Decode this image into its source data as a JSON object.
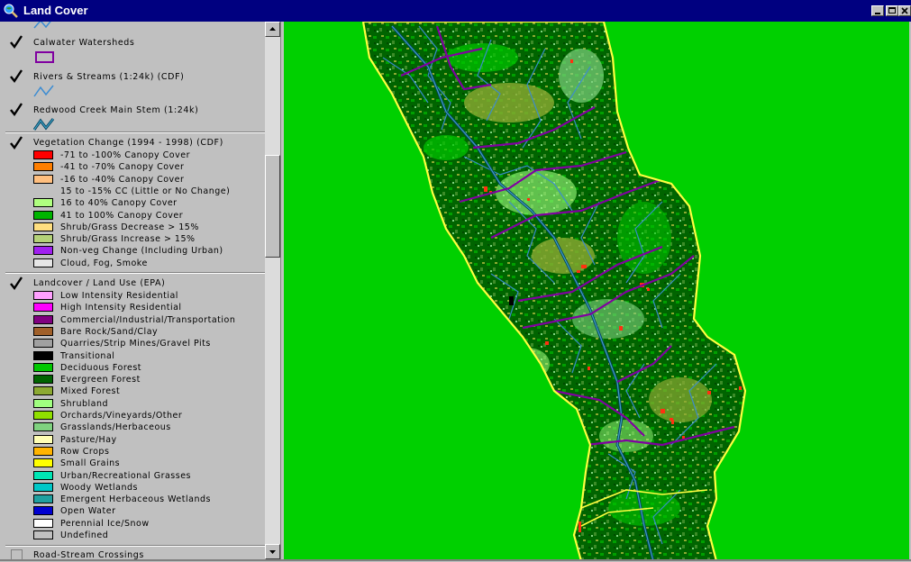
{
  "window": {
    "title": "Land Cover",
    "icon": "globe-magnifier-icon"
  },
  "legend": {
    "themes": [
      {
        "name": "Calwater Watersheds",
        "checked": true,
        "symbol": "purple-polygon"
      },
      {
        "name": "Rivers & Streams (1:24k) (CDF)",
        "checked": true,
        "symbol": "blue-line"
      },
      {
        "name": "Redwood Creek Main Stem (1:24k)",
        "checked": true,
        "symbol": "teal-line"
      },
      {
        "name": "Vegetation Change (1994 - 1998) (CDF)",
        "checked": true,
        "entries": [
          {
            "label": "-71 to -100% Canopy Cover",
            "color": "#ff0000"
          },
          {
            "label": "-41 to -70% Canopy Cover",
            "color": "#ff7f00"
          },
          {
            "label": "-16 to -40% Canopy Cover",
            "color": "#ffbf7f"
          },
          {
            "label": "15 to -15% CC (Little or No Change)",
            "color": ""
          },
          {
            "label": "16 to 40% Canopy Cover",
            "color": "#afff7f"
          },
          {
            "label": "41 to 100% Canopy Cover",
            "color": "#00b400"
          },
          {
            "label": "Shrub/Grass Decrease > 15%",
            "color": "#ffdf80"
          },
          {
            "label": "Shrub/Grass Increase > 15%",
            "color": "#b4d278"
          },
          {
            "label": "Non-veg Change (Including Urban)",
            "color": "#a020f0"
          },
          {
            "label": "Cloud, Fog, Smoke",
            "color": "#e6e6e6"
          }
        ]
      },
      {
        "name": "Landcover / Land Use (EPA)",
        "checked": true,
        "entries": [
          {
            "label": "Low Intensity Residential",
            "color": "#ffa0ff"
          },
          {
            "label": "High Intensity Residential",
            "color": "#ff00ff"
          },
          {
            "label": "Commercial/Industrial/Transportation",
            "color": "#800080"
          },
          {
            "label": "Bare Rock/Sand/Clay",
            "color": "#a0602a"
          },
          {
            "label": "Quarries/Strip Mines/Gravel Pits",
            "color": "#a0a0a0"
          },
          {
            "label": "Transitional",
            "color": "#000000"
          },
          {
            "label": "Deciduous Forest",
            "color": "#00c800"
          },
          {
            "label": "Evergreen Forest",
            "color": "#006400"
          },
          {
            "label": "Mixed Forest",
            "color": "#8caa32"
          },
          {
            "label": "Shrubland",
            "color": "#a0ff80"
          },
          {
            "label": "Orchards/Vineyards/Other",
            "color": "#90e000"
          },
          {
            "label": "Grasslands/Herbaceous",
            "color": "#7fd27f"
          },
          {
            "label": "Pasture/Hay",
            "color": "#ffffb4"
          },
          {
            "label": "Row Crops",
            "color": "#ffb400"
          },
          {
            "label": "Small Grains",
            "color": "#ffff00"
          },
          {
            "label": "Urban/Recreational Grasses",
            "color": "#00e6b4"
          },
          {
            "label": "Woody Wetlands",
            "color": "#00c8c8"
          },
          {
            "label": "Emergent Herbaceous Wetlands",
            "color": "#20a0a0"
          },
          {
            "label": "Open Water",
            "color": "#0000d0"
          },
          {
            "label": "Perennial Ice/Snow",
            "color": "#ffffff"
          },
          {
            "label": "Undefined",
            "color": "#c0c0c0"
          }
        ]
      },
      {
        "name": "Road-Stream Crossings",
        "checked": false
      }
    ]
  },
  "map": {
    "background_color": "#00d000",
    "boundary_color": "#ffff40",
    "watershed_line_color": "#8000a0",
    "stream_color": "#3c8cd2",
    "forest_color": "#006400"
  }
}
